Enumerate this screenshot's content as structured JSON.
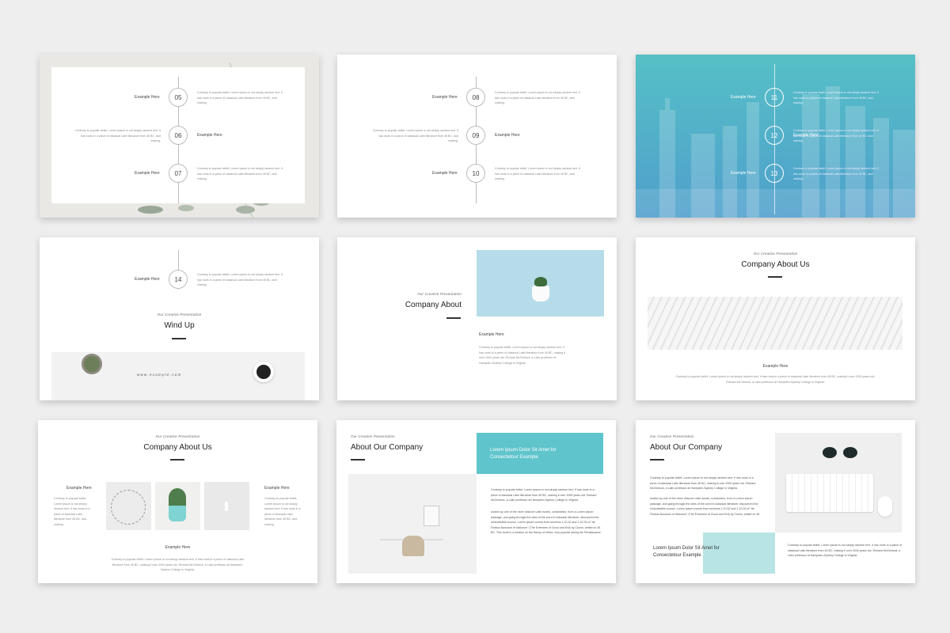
{
  "colors": {
    "teal": "#5fc4cc",
    "light_teal": "#b8e4e6",
    "blue_overlay": "#4fb3c9"
  },
  "example_label": "Example Here",
  "lorem_short": "Contrary to popular belief, Lorem Ipsum is not simply random text. It has roots in a piece of classical Latin literature from 45 BC, and making.",
  "lorem_long": "Contrary to popular belief, Lorem Ipsum is not simply random text. It has roots in a piece of classical Latin literature from 45 BC, making it over 2000 years old. Richard McClintock, a Latin professor at Hampden-Sydney College in Virginia.",
  "lorem_extra": "looked up one of the more obscure Latin words, consectetur, from a Lorem Ipsum passage, and going through the cites of the word in classical literature, discovered the undoubtable source. Lorem Ipsum comes from sections 1.10.32 and 1.10.33 of \"de Finibus Bonorum et Malorum\" (The Extremes of Good and Evil) by Cicero, written in 45 BC. This book is a treatise on the theory of ethics, very popular during the Renaissance.",
  "kicker": "Our Creative Presentation",
  "slide1": {
    "numbers": [
      "05",
      "06",
      "07"
    ]
  },
  "slide2": {
    "numbers": [
      "08",
      "09",
      "10"
    ]
  },
  "slide3": {
    "numbers": [
      "11",
      "12",
      "13"
    ]
  },
  "slide4": {
    "number": "14",
    "title": "Wind Up",
    "url": "w w w . e x a m p l e . c o m"
  },
  "slide5": {
    "title": "Company About"
  },
  "slide6": {
    "title": "Company About Us"
  },
  "slide7": {
    "title": "Company About Us"
  },
  "slide8": {
    "title": "About Our Company",
    "box_text": "Lorem Ipsum Dolor Sit Amet for Consectetour Example"
  },
  "slide9": {
    "title": "About Our Company",
    "box_text": "Lorem Ipsum Dolor Sit Amet for Consectetour Example"
  }
}
